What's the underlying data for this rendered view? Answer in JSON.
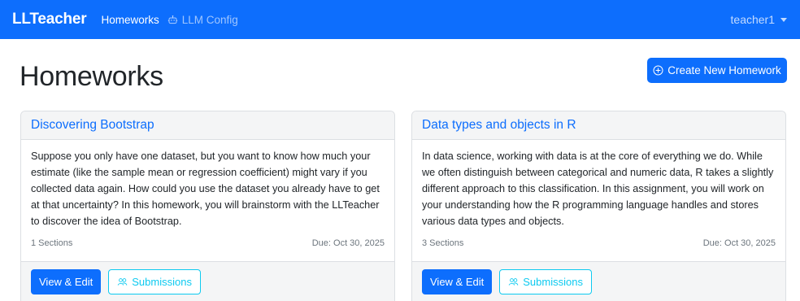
{
  "navbar": {
    "brand": "LLTeacher",
    "links": [
      {
        "label": "Homeworks",
        "icon": "none"
      },
      {
        "label": "LLM Config",
        "icon": "robot-icon"
      }
    ],
    "user": "teacher1"
  },
  "page": {
    "title": "Homeworks",
    "create_button": "Create New Homework"
  },
  "homeworks": [
    {
      "title": "Discovering Bootstrap",
      "description": "Suppose you only have one dataset, but you want to know how much your estimate (like the sample mean or regression coefficient) might vary if you collected data again. How could you use the dataset you already have to get at that uncertainty? In this homework, you will brainstorm with the LLTeacher to discover the idea of Bootstrap.",
      "sections": "1 Sections",
      "due": "Due: Oct 30, 2025",
      "view_label": "View & Edit",
      "submissions_label": "Submissions"
    },
    {
      "title": "Data types and objects in R",
      "description": "In data science, working with data is at the core of everything we do. While we often distinguish between categorical and numeric data, R takes a slightly different approach to this classification. In this assignment, you will work on your understanding how the R programming language handles and stores various data types and objects.",
      "sections": "3 Sections",
      "due": "Due: Oct 30, 2025",
      "view_label": "View & Edit",
      "submissions_label": "Submissions"
    }
  ],
  "colors": {
    "primary": "#0d6efd",
    "info": "#0dcaf0",
    "card_header_bg": "#f4f5f6",
    "muted_text": "#6c757d"
  }
}
